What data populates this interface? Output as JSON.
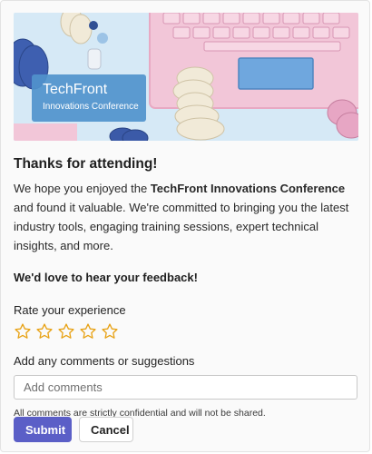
{
  "hero": {
    "brand_title": "TechFront",
    "brand_subtitle": "Innovations Conference"
  },
  "main": {
    "title": "Thanks for attending!",
    "intro_before": "We hope you enjoyed the ",
    "intro_bold": "TechFront Innovations Conference",
    "intro_after": " and found it valuable. We're committed to bringing you the latest industry tools, engaging training sessions, expert technical insights, and more.",
    "feedback_heading": "We'd love to hear your feedback!",
    "rate_label": "Rate your experience",
    "rating": {
      "max": 5,
      "selected": 0,
      "star_color": "#e8a317"
    },
    "comments_label": "Add any comments or suggestions",
    "comments_placeholder": "Add comments",
    "comments_value": "",
    "confidential_note": "All comments are strictly confidential and will not be shared."
  },
  "actions": {
    "submit_label": "Submit",
    "cancel_label": "Cancel"
  },
  "colors": {
    "primary": "#5b5fc7",
    "brand_box": "#5092cc"
  }
}
